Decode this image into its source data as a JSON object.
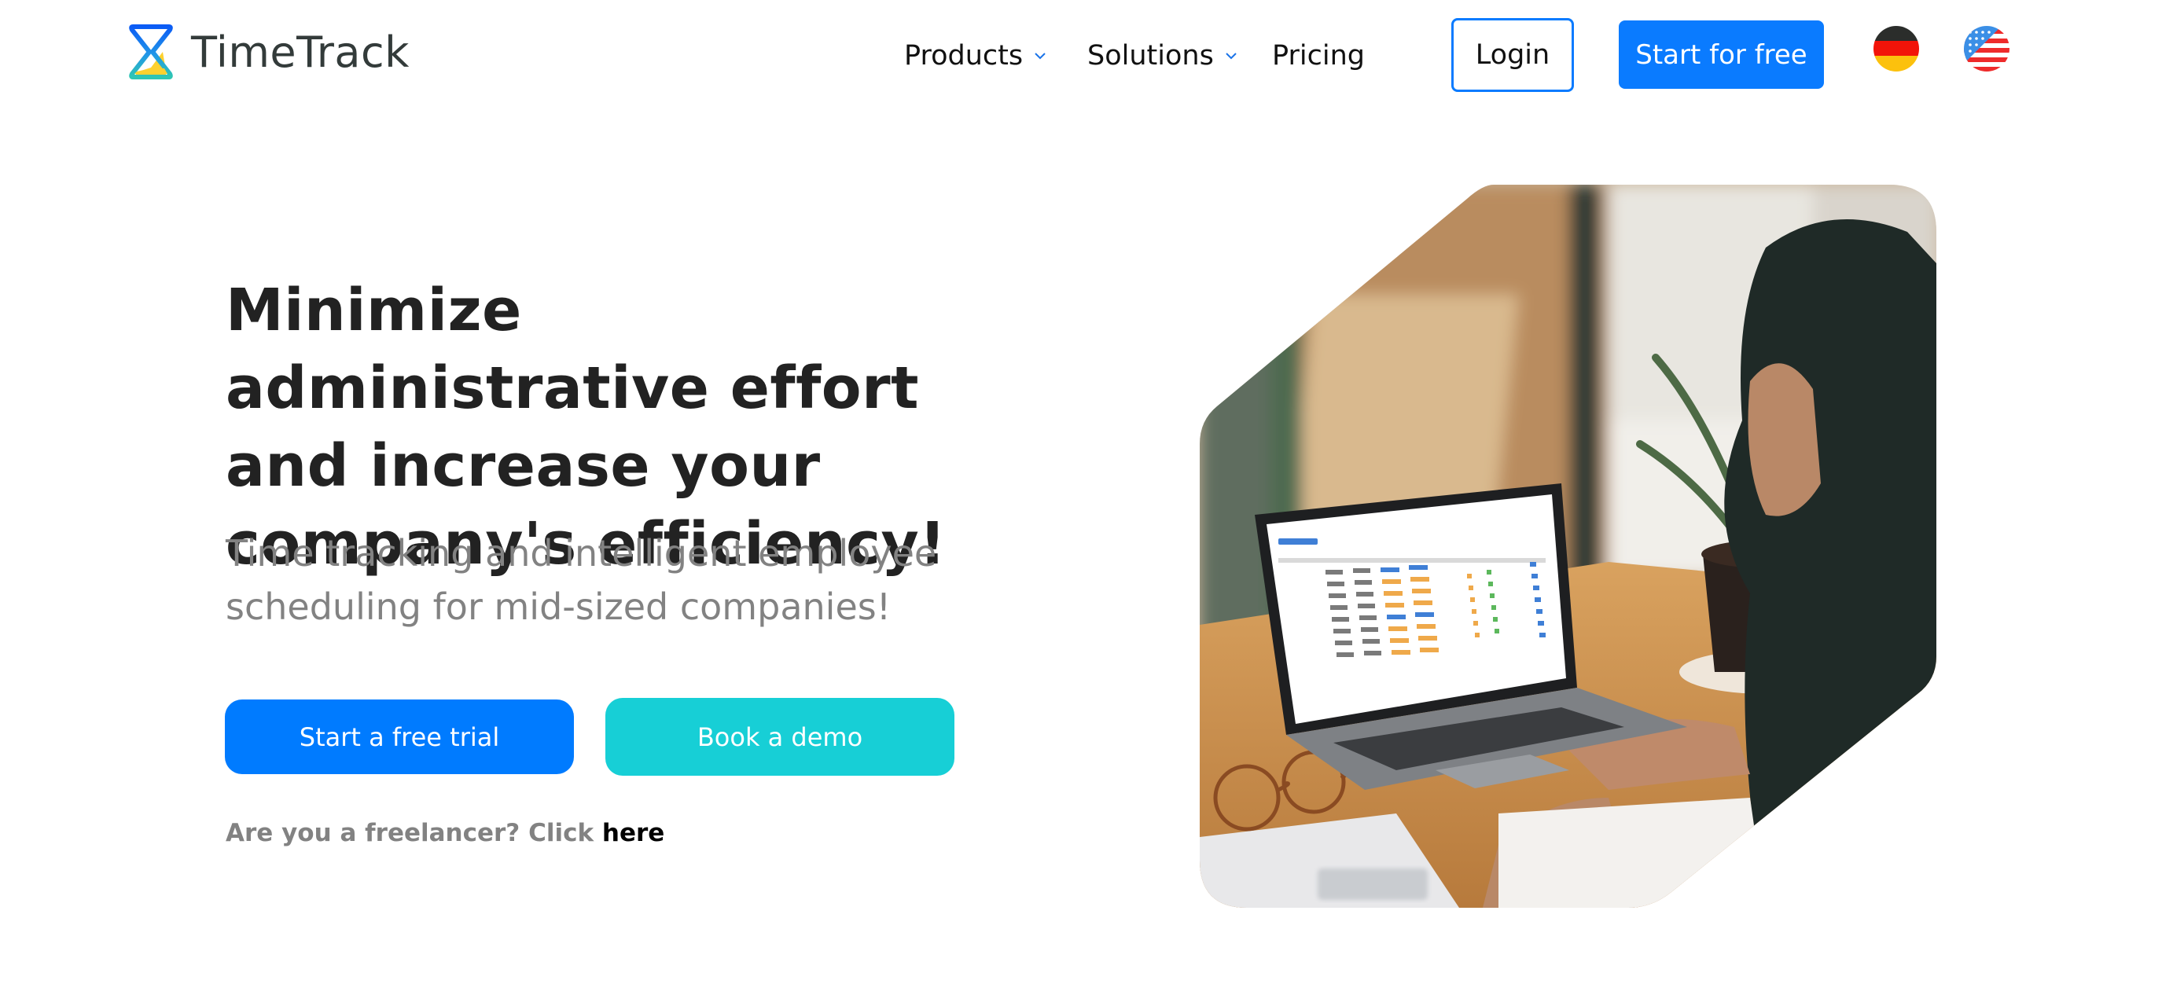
{
  "header": {
    "logo_text": "TimeTrack",
    "nav": [
      {
        "label": "Products",
        "has_dropdown": true
      },
      {
        "label": "Solutions",
        "has_dropdown": true
      },
      {
        "label": "Pricing",
        "has_dropdown": false
      }
    ],
    "login_label": "Login",
    "start_free_label": "Start for free",
    "languages": [
      {
        "code": "de",
        "icon": "germany-flag-icon"
      },
      {
        "code": "en-us",
        "icon": "usa-flag-icon"
      }
    ]
  },
  "hero": {
    "title": "Minimize administrative effort and increase your company's efficiency!",
    "subtitle": "Time tracking and intelligent employee scheduling for mid-sized companies!",
    "primary_cta": "Start a free trial",
    "secondary_cta": "Book a demo",
    "freelancer_prompt": "Are you a freelancer? Click",
    "freelancer_link": "here",
    "image_alt": "Man working on a laptop showing a time-tracking table"
  },
  "colors": {
    "primary": "#007bff",
    "accent": "#17cfd6",
    "text_dark": "#222222",
    "text_muted": "#828282"
  }
}
